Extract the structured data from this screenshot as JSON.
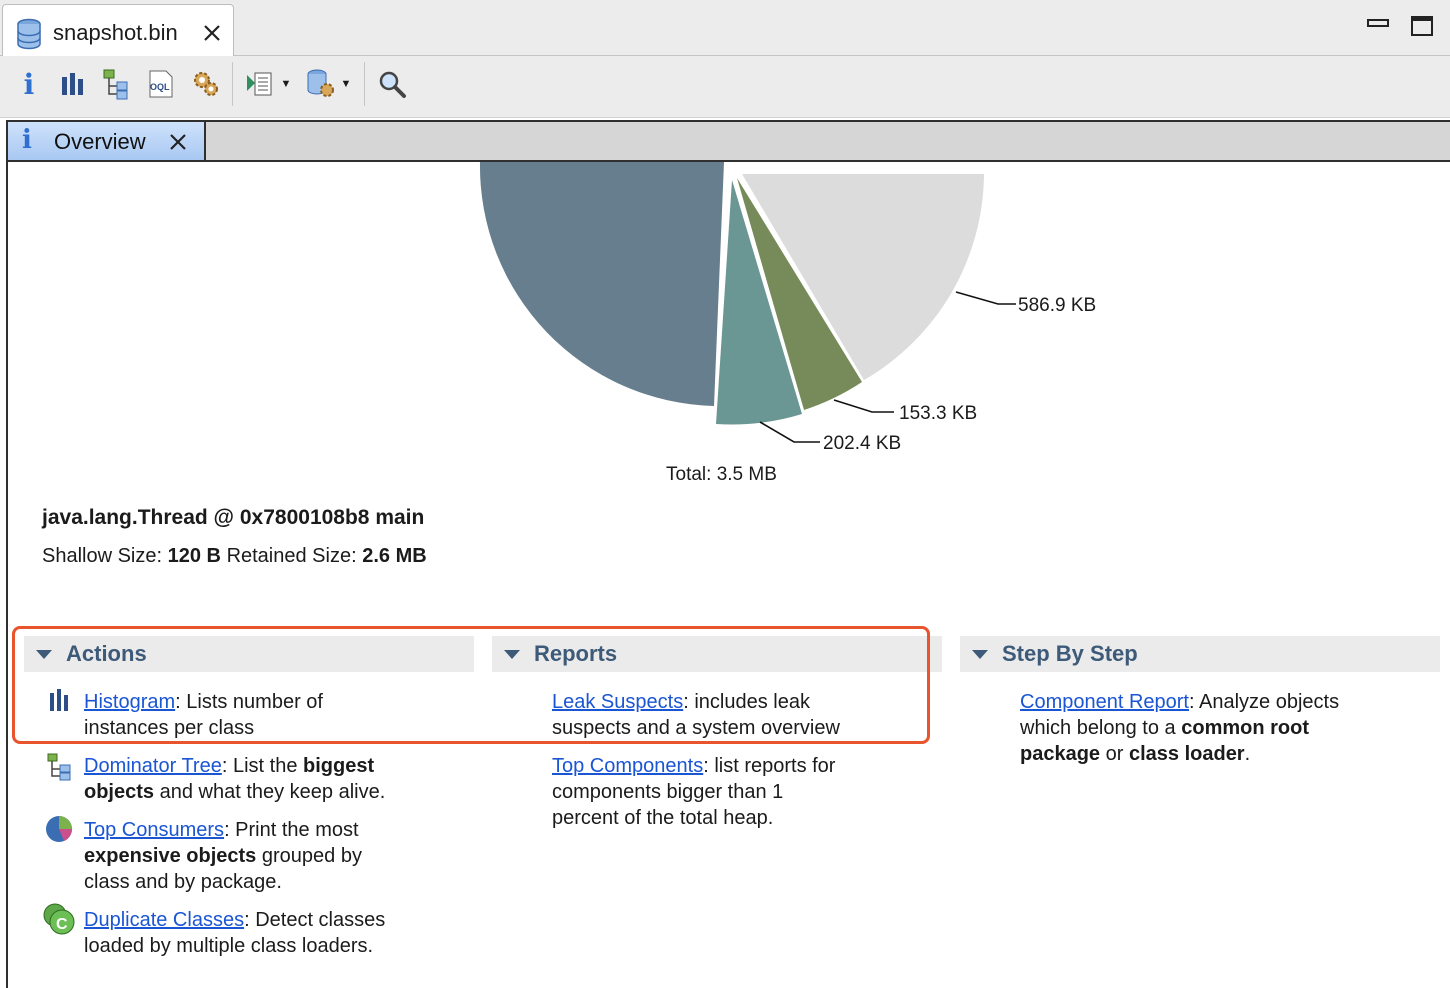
{
  "editor": {
    "tab_title": "snapshot.bin",
    "icons": [
      "database-icon",
      "close-icon",
      "minimize-icon",
      "maximize-icon"
    ]
  },
  "toolbar": {
    "buttons": [
      {
        "name": "overview-button",
        "icon": "info-icon"
      },
      {
        "name": "histogram-button",
        "icon": "histogram-icon"
      },
      {
        "name": "dominator-tree-button",
        "icon": "dominator-tree-icon"
      },
      {
        "name": "oql-button",
        "icon": "oql-icon"
      },
      {
        "name": "heap-dump-overview-button",
        "icon": "gear-icon"
      },
      {
        "name": "query-browser-button",
        "icon": "query-browser-icon"
      },
      {
        "name": "run-report-button",
        "icon": "report-icon"
      },
      {
        "name": "search-button",
        "icon": "search-icon"
      }
    ]
  },
  "overview_tab": {
    "label": "Overview"
  },
  "chart_data": {
    "type": "pie",
    "slice_labels": [
      "586.9 KB",
      "153.3 KB",
      "202.4 KB"
    ],
    "values": [
      586.9,
      153.3,
      202.4
    ],
    "total_label": "Total: 3.5 MB",
    "colors": [
      "#dcdcdc",
      "#768b59",
      "#6a9693",
      "#667e8e"
    ]
  },
  "object": {
    "title": "java.lang.Thread @ 0x7800108b8 main",
    "shallow_label": "Shallow Size:",
    "shallow_value": "120 B",
    "retained_label": "Retained Size:",
    "retained_value": "2.6 MB"
  },
  "sections": {
    "actions": {
      "title": "Actions",
      "items": [
        {
          "link": "Histogram",
          "text1": ": Lists number of",
          "text2": "instances per class"
        },
        {
          "link": "Dominator Tree",
          "text1": ": List the ",
          "bold1": "biggest",
          "bold2": "objects",
          "text2": " and what they keep alive."
        },
        {
          "link": "Top Consumers",
          "text1": ": Print the most",
          "bold2": "expensive objects",
          "text2": " grouped by",
          "text3": "class and by package."
        },
        {
          "link": "Duplicate Classes",
          "text1": ": Detect classes",
          "text2": "loaded by multiple class loaders."
        }
      ]
    },
    "reports": {
      "title": "Reports",
      "items": [
        {
          "link": "Leak Suspects",
          "text1": ": includes leak",
          "text2": "suspects and a system overview"
        },
        {
          "link": "Top Components",
          "text1": ": list reports for",
          "text2": "components bigger than 1",
          "text3": "percent of the total heap."
        }
      ]
    },
    "step_by_step": {
      "title": "Step By Step",
      "items": [
        {
          "link": "Component Report",
          "text1": ": Analyze objects",
          "text2a": "which belong to a ",
          "bold2": "common root",
          "bold3a": "package",
          "text3": " or ",
          "bold3b": "class loader",
          "text3end": "."
        }
      ]
    }
  }
}
